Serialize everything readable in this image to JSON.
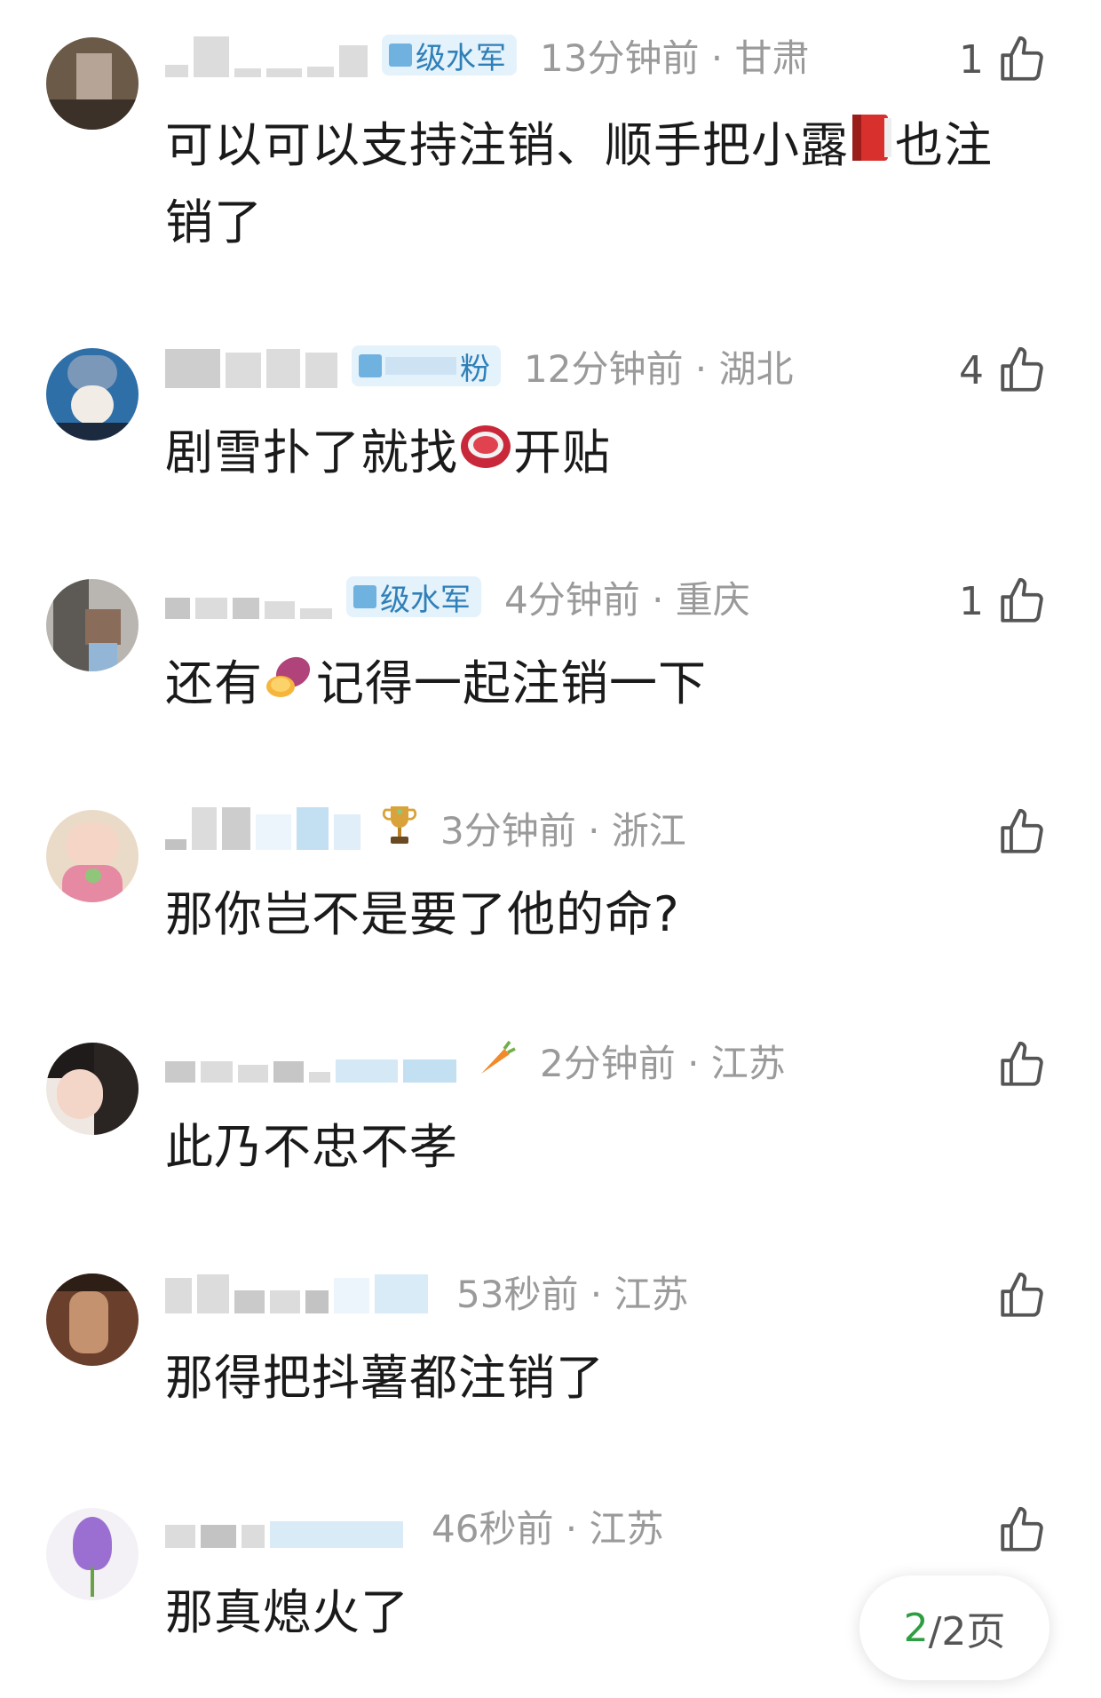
{
  "comments": [
    {
      "badge": "级水军",
      "time": "13分钟前 · 甘肃",
      "likes": "1",
      "text_a": "可以可以支持注销、顺手把小露",
      "text_b": "也注销了",
      "emoji": "red-book-icon"
    },
    {
      "badge": "粉",
      "time": "12分钟前 · 湖北",
      "likes": "4",
      "text_a": "剧雪扑了就找",
      "text_b": "开贴",
      "emoji": "meat-icon"
    },
    {
      "badge": "级水军",
      "time": "4分钟前 · 重庆",
      "likes": "1",
      "text_a": "还有",
      "text_b": "记得一起注销一下",
      "emoji": "sweet-potato-icon"
    },
    {
      "badge": "",
      "time": "3分钟前 · 浙江",
      "likes": "",
      "text_a": "那你岂不是要了他的命?",
      "text_b": "",
      "emoji": "trophy-icon"
    },
    {
      "badge": "",
      "time": "2分钟前 · 江苏",
      "likes": "",
      "text_a": "此乃不忠不孝",
      "text_b": "",
      "emoji": "carrot-icon"
    },
    {
      "badge": "",
      "time": "53秒前 · 江苏",
      "likes": "",
      "text_a": "那得把抖薯都注销了",
      "text_b": "",
      "emoji": ""
    },
    {
      "badge": "",
      "time": "46秒前 · 江苏",
      "likes": "",
      "text_a": "那真熄火了",
      "text_b": "",
      "emoji": ""
    }
  ],
  "pager": {
    "current": "2",
    "rest": "/2页"
  }
}
